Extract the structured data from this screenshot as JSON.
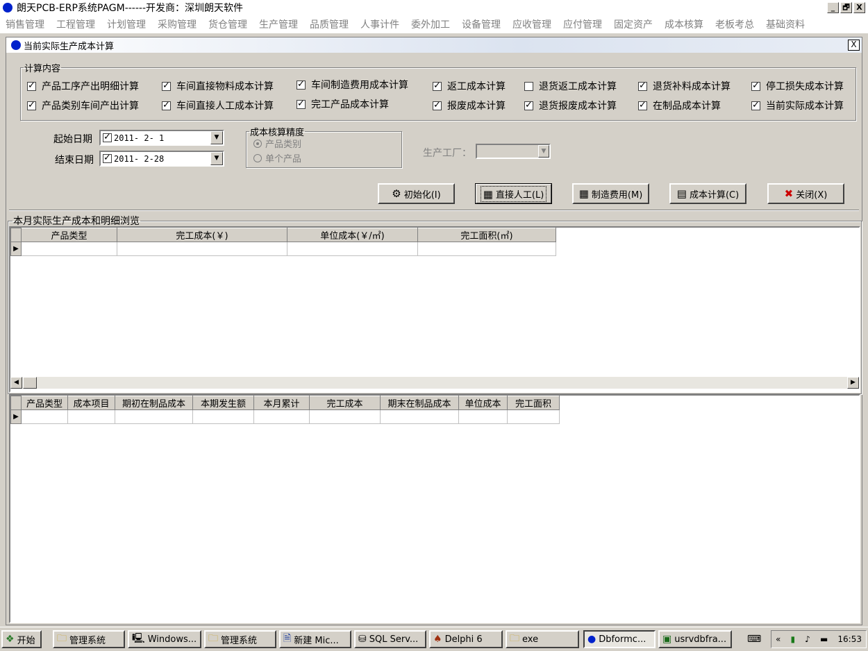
{
  "app": {
    "title": "朗天PCB-ERP系统PAGM------开发商：深圳朗天软件",
    "window_buttons": [
      "_",
      "🗗",
      "X"
    ]
  },
  "menu": [
    "销售管理",
    "工程管理",
    "计划管理",
    "采购管理",
    "货仓管理",
    "生产管理",
    "品质管理",
    "人事计件",
    "委外加工",
    "设备管理",
    "应收管理",
    "应付管理",
    "固定资产",
    "成本核算",
    "老板考总",
    "基础资料"
  ],
  "child": {
    "title": "当前实际生产成本计算",
    "close": "X"
  },
  "calc_group": {
    "legend": "计算内容",
    "items": [
      {
        "label": "产品工序产出明细计算",
        "checked": true
      },
      {
        "label": "车间直接物料成本计算",
        "checked": true
      },
      {
        "label": "车间制造费用成本计算",
        "checked": true
      },
      {
        "label": "返工成本计算",
        "checked": true
      },
      {
        "label": "退货返工成本计算",
        "checked": false
      },
      {
        "label": "退货补料成本计算",
        "checked": true
      },
      {
        "label": "停工损失成本计算",
        "checked": true
      },
      {
        "label": "产品类别车间产出计算",
        "checked": true
      },
      {
        "label": "车间直接人工成本计算",
        "checked": true
      },
      {
        "label": "完工产品成本计算",
        "checked": true
      },
      {
        "label": "报废成本计算",
        "checked": true
      },
      {
        "label": "退货报废成本计算",
        "checked": true
      },
      {
        "label": "在制品成本计算",
        "checked": true
      },
      {
        "label": "当前实际成本计算",
        "checked": true
      }
    ]
  },
  "dates": {
    "start_label": "起始日期",
    "start_value": "2011- 2- 1",
    "end_label": "结束日期",
    "end_value": "2011- 2-28"
  },
  "precision": {
    "legend": "成本核算精度",
    "options": [
      {
        "label": "产品类别",
        "selected": true
      },
      {
        "label": "单个产品",
        "selected": false
      }
    ]
  },
  "factory": {
    "label": "生产工厂：",
    "value": ""
  },
  "buttons": {
    "init": "初始化(I)",
    "direct_labor": "直接人工(L)",
    "mfg_cost": "制造费用(M)",
    "cost_calc": "成本计算(C)",
    "close": "关闭(X)"
  },
  "summary_section": {
    "title": "本月实际生产成本和明细浏览",
    "columns": [
      "产品类型",
      "完工成本(￥)",
      "单位成本(￥/㎡)",
      "完工面积(㎡)"
    ]
  },
  "detail_grid": {
    "columns": [
      "产品类型",
      "成本项目",
      "期初在制品成本",
      "本期发生额",
      "本月累计",
      "完工成本",
      "期末在制品成本",
      "单位成本",
      "完工面积"
    ]
  },
  "taskbar": {
    "start": "开始",
    "tasks": [
      {
        "label": "管理系统",
        "icon": "folder-icon"
      },
      {
        "label": "Windows...",
        "icon": "computer-icon"
      },
      {
        "label": "管理系统",
        "icon": "folder-icon"
      },
      {
        "label": "新建 Mic...",
        "icon": "document-icon"
      },
      {
        "label": "SQL Serv...",
        "icon": "database-icon"
      },
      {
        "label": "Delphi 6",
        "icon": "delphi-icon"
      },
      {
        "label": "exe",
        "icon": "folder-icon"
      },
      {
        "label": "Dbformc...",
        "icon": "app-dot-icon",
        "active": true
      },
      {
        "label": "usrvdbfra...",
        "icon": "app-icon"
      }
    ],
    "tray_arrow": "«",
    "clock": "16:53"
  }
}
